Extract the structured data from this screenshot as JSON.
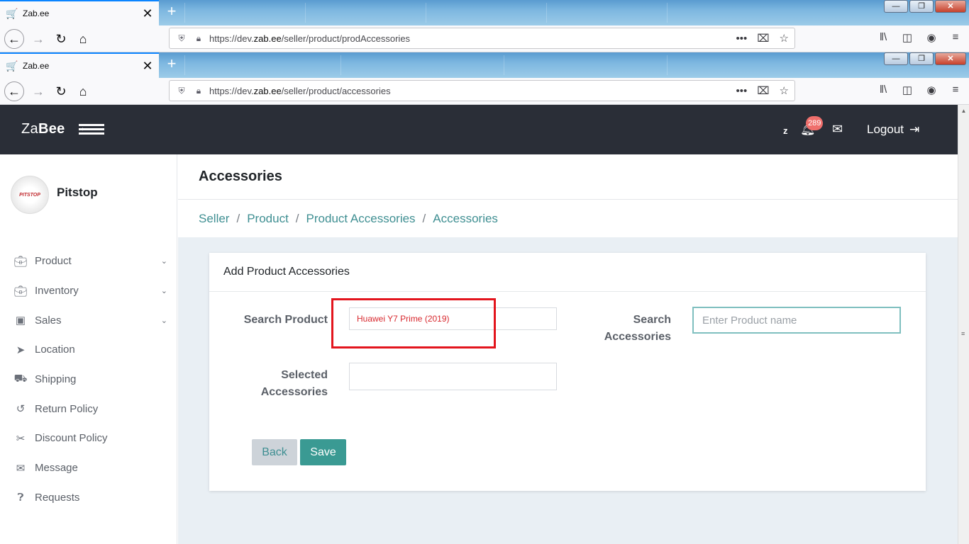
{
  "browser_windows": [
    {
      "tab_title": "Zab.ee",
      "url_prefix": "https://dev.",
      "url_domain": "zab.ee",
      "url_path": "/seller/product/prodAccessories"
    },
    {
      "tab_title": "Zab.ee",
      "url_prefix": "https://dev.",
      "url_domain": "zab.ee",
      "url_path": "/seller/product/accessories"
    }
  ],
  "header": {
    "logo_light": "Za",
    "logo_bold": "Bee",
    "user_initial": "z",
    "notification_count": "289",
    "logout_label": "Logout"
  },
  "sidebar": {
    "store_name": "Pitstop",
    "avatar_text": "PITSTOP",
    "items": [
      {
        "label": "Product",
        "icon": "briefcase-icon",
        "has_submenu": true
      },
      {
        "label": "Inventory",
        "icon": "briefcase-icon",
        "has_submenu": true
      },
      {
        "label": "Sales",
        "icon": "money-icon",
        "has_submenu": true
      },
      {
        "label": "Location",
        "icon": "location-arrow-icon",
        "has_submenu": false
      },
      {
        "label": "Shipping",
        "icon": "truck-icon",
        "has_submenu": false
      },
      {
        "label": "Return Policy",
        "icon": "undo-icon",
        "has_submenu": false
      },
      {
        "label": "Discount Policy",
        "icon": "scissors-icon",
        "has_submenu": false
      },
      {
        "label": "Message",
        "icon": "envelope-icon",
        "has_submenu": false
      },
      {
        "label": "Requests",
        "icon": "question-icon",
        "has_submenu": false
      }
    ]
  },
  "main": {
    "page_title": "Accessories",
    "breadcrumbs": [
      "Seller",
      "Product",
      "Product Accessories",
      "Accessories"
    ],
    "form": {
      "heading": "Add Product Accessories",
      "search_product_label": "Search Product",
      "search_product_value": "Huawei Y7 Prime (2019)",
      "search_accessories_label_1": "Search",
      "search_accessories_label_2": "Accessories",
      "search_accessories_placeholder": "Enter Product name",
      "selected_accessories_label_1": "Selected",
      "selected_accessories_label_2": "Accessories",
      "selected_accessories_value": "",
      "back_label": "Back",
      "save_label": "Save"
    }
  },
  "colors": {
    "header_bg": "#2a2e37",
    "accent_teal": "#3a9a93",
    "link_teal": "#3f8f92",
    "highlight_red": "#e3151d",
    "badge": "#ef6f6c"
  }
}
